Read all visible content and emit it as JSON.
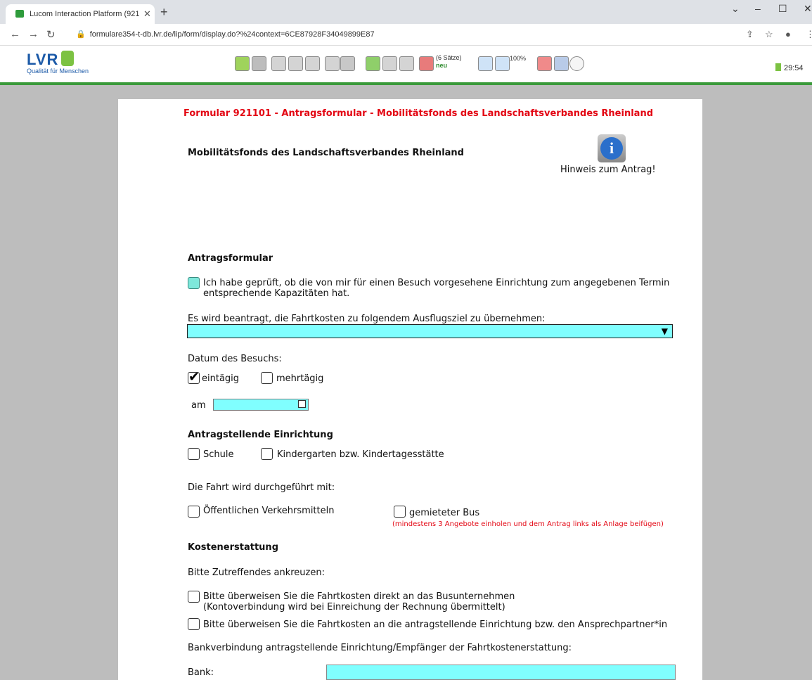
{
  "browser": {
    "tab_title": "Lucom Interaction Platform (921",
    "url": "formulare354-t-db.lvr.de/lip/form/display.do?%24context=6CE87928F34049899E87"
  },
  "app": {
    "logo_text": "LVR",
    "logo_tagline": "Qualität für Menschen",
    "toolbar_records": "(6 Sätze)",
    "toolbar_new": "neu",
    "toolbar_zoom": "100%",
    "timer": "29:54"
  },
  "form": {
    "header": "Formular 921101 - Antragsformular - Mobilitätsfonds des Landschaftsverbandes Rheinland",
    "title": "Mobilitätsfonds des Landschaftsverbandes Rheinland",
    "info_label": "Hinweis zum Antrag!",
    "section_antrag": "Antragsformular",
    "check_capacity_line1": "Ich habe geprüft, ob die von mir für einen Besuch vorgesehene Einrichtung zum angegebenen Termin",
    "check_capacity_line2": "entsprechende Kapazitäten hat.",
    "destination_label": "Es wird beantragt, die Fahrtkosten zu folgendem Ausflugsziel zu übernehmen:",
    "date_label": "Datum des Besuchs:",
    "opt_eintaegig": "eintägig",
    "opt_mehrtaegig": "mehrtägig",
    "am_label": "am",
    "section_einrichtung": "Antragstellende Einrichtung",
    "opt_schule": "Schule",
    "opt_kita": "Kindergarten bzw. Kindertagesstätte",
    "transport_label": "Die Fahrt wird durchgeführt mit:",
    "opt_oepnv": "Öffentlichen Verkehrsmitteln",
    "opt_bus": "gemieteter Bus",
    "bus_note": "(mindestens 3 Angebote einholen und dem Antrag links als Anlage beifügen)",
    "section_kosten": "Kostenerstattung",
    "tick_label": "Bitte Zutreffendes ankreuzen:",
    "opt_direct_line1": "Bitte überweisen Sie die Fahrtkosten direkt an das Busunternehmen",
    "opt_direct_line2": "(Kontoverbindung wird bei Einreichung der Rechnung übermittelt)",
    "opt_einrichtung": "Bitte überweisen Sie die Fahrtkosten an die antragstellende Einrichtung bzw. den Ansprechpartner*in",
    "bank_info_label": "Bankverbindung antragstellende Einrichtung/Empfänger der Fahrtkostenerstattung:",
    "bank_label": "Bank:"
  },
  "colors": {
    "field": "#80ffff",
    "header_red": "#e30613",
    "green_line": "#3a9a3a"
  }
}
